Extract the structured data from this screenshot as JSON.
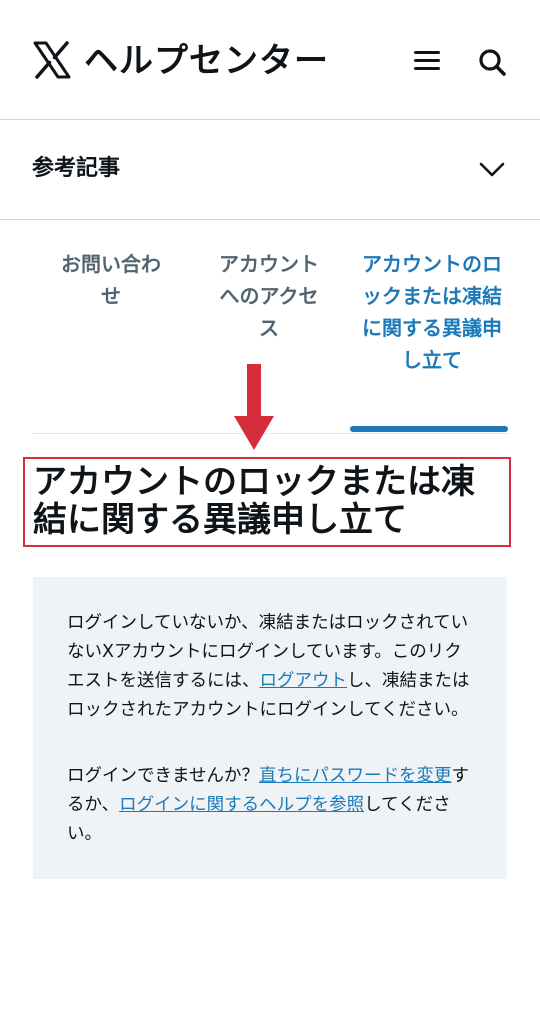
{
  "header": {
    "brand": "ヘルプセンター",
    "logo_icon": "x-logo-icon",
    "menu_icon": "hamburger-menu-icon",
    "search_icon": "search-icon"
  },
  "related": {
    "label": "参考記事",
    "icon": "chevron-down-icon"
  },
  "tabs": [
    {
      "label": "お問い合わせ",
      "active": false
    },
    {
      "label": "アカウントへのアクセス",
      "active": false
    },
    {
      "label": "アカウントのロックまたは凍結に関する異議申し立て",
      "active": true
    }
  ],
  "annotation": {
    "arrow_color": "#d62d3a",
    "box_color": "#d62d3a"
  },
  "page_title": "アカウントのロックまたは凍結に関する異議申し立て",
  "notice": {
    "p1_text_a": "ログインしていないか、凍結またはロックされていないXアカウントにログインしています。このリクエストを送信するには、",
    "p1_link": "ログアウト",
    "p1_text_b": "し、凍結またはロックされたアカウントにログインしてください。",
    "p2_text_a": "ログインできませんか？",
    "p2_link1": "直ちにパスワードを変更",
    "p2_text_b": "するか、",
    "p2_link2": "ログインに関するヘルプを参照",
    "p2_text_c": "してください。"
  },
  "colors": {
    "accent": "#1d7ab8",
    "text": "#0f1419",
    "muted": "#536471",
    "notice_bg": "#eff3f6"
  }
}
